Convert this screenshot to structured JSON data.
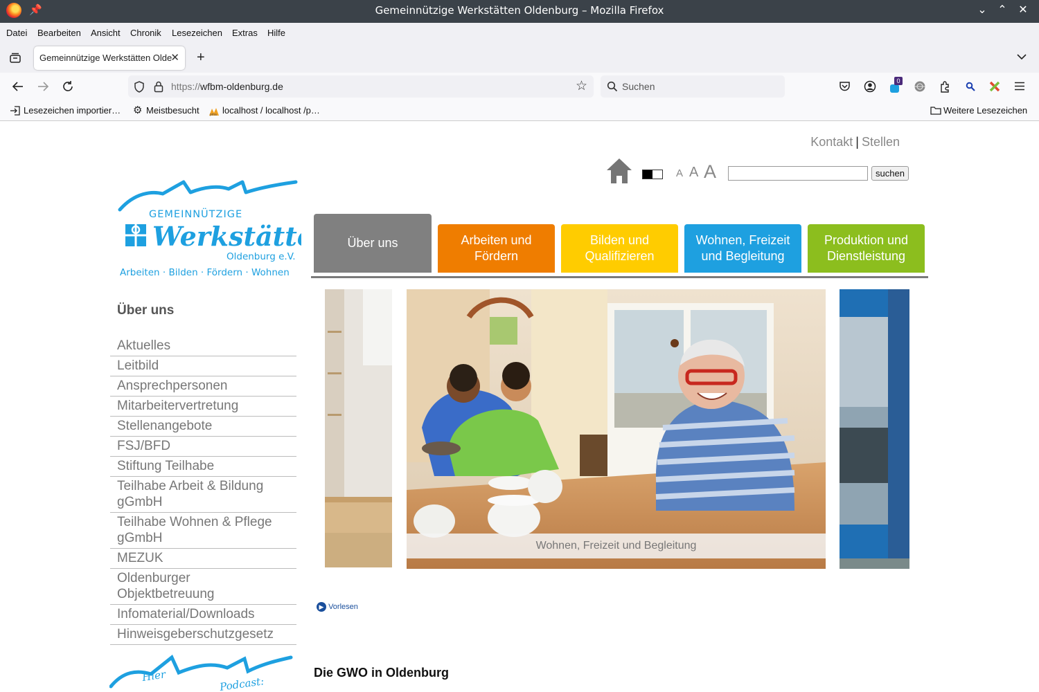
{
  "browser": {
    "window_title": "Gemeinnützige Werkstätten Oldenburg – Mozilla Firefox",
    "menu": [
      "Datei",
      "Bearbeiten",
      "Ansicht",
      "Chronik",
      "Lesezeichen",
      "Extras",
      "Hilfe"
    ],
    "tab_title": "Gemeinnützige Werkstätten Olde",
    "url_protocol": "https://",
    "url_host": "wfbm-oldenburg.de",
    "search_placeholder": "Suchen",
    "extension_badge": "0",
    "bookmarks": [
      "Lesezeichen importier…",
      "Meistbesucht",
      "localhost / localhost /p…"
    ],
    "other_bookmarks": "Weitere Lesezeichen"
  },
  "page": {
    "top_links": {
      "contact": "Kontakt",
      "separator": "|",
      "jobs": "Stellen"
    },
    "font_sizes": [
      "A",
      "A",
      "A"
    ],
    "search_button": "suchen",
    "logo": {
      "line1": "GEMEINNÜTZIGE",
      "line2": "Werkstätten",
      "line3": "Oldenburg e.V.",
      "tagline": "Arbeiten · Bilden · Fördern · Wohnen"
    },
    "main_nav": [
      {
        "label": "Über uns",
        "color": "#808080"
      },
      {
        "label": "Arbeiten und Fördern",
        "color": "#ef7d00"
      },
      {
        "label": "Bilden und Qualifizieren",
        "color": "#ffcc00"
      },
      {
        "label": "Wohnen, Freizeit und Begleitung",
        "color": "#1ea0e0"
      },
      {
        "label": "Produktion und Dienstleistung",
        "color": "#8cbe1e"
      }
    ],
    "sidebar": {
      "heading": "Über uns",
      "items": [
        "Aktuelles",
        "Leitbild",
        "Ansprechpersonen",
        "Mitarbeitervertretung",
        "Stellenangebote",
        "FSJ/BFD",
        "Stiftung Teilhabe",
        "Teilhabe Arbeit & Bildung gGmbH",
        "Teilhabe Wohnen & Pflege gGmbH",
        "MEZUK",
        "Oldenburger Objektbetreuung",
        "Infomaterial/Downloads",
        "Hinweisgeberschutzgesetz"
      ]
    },
    "slider_caption": "Wohnen, Freizeit und Begleitung",
    "read_aloud": "Vorlesen",
    "section_title": "Die GWO in Oldenburg",
    "podcast": {
      "word1": "Hier",
      "word2": "Podcast:"
    }
  }
}
